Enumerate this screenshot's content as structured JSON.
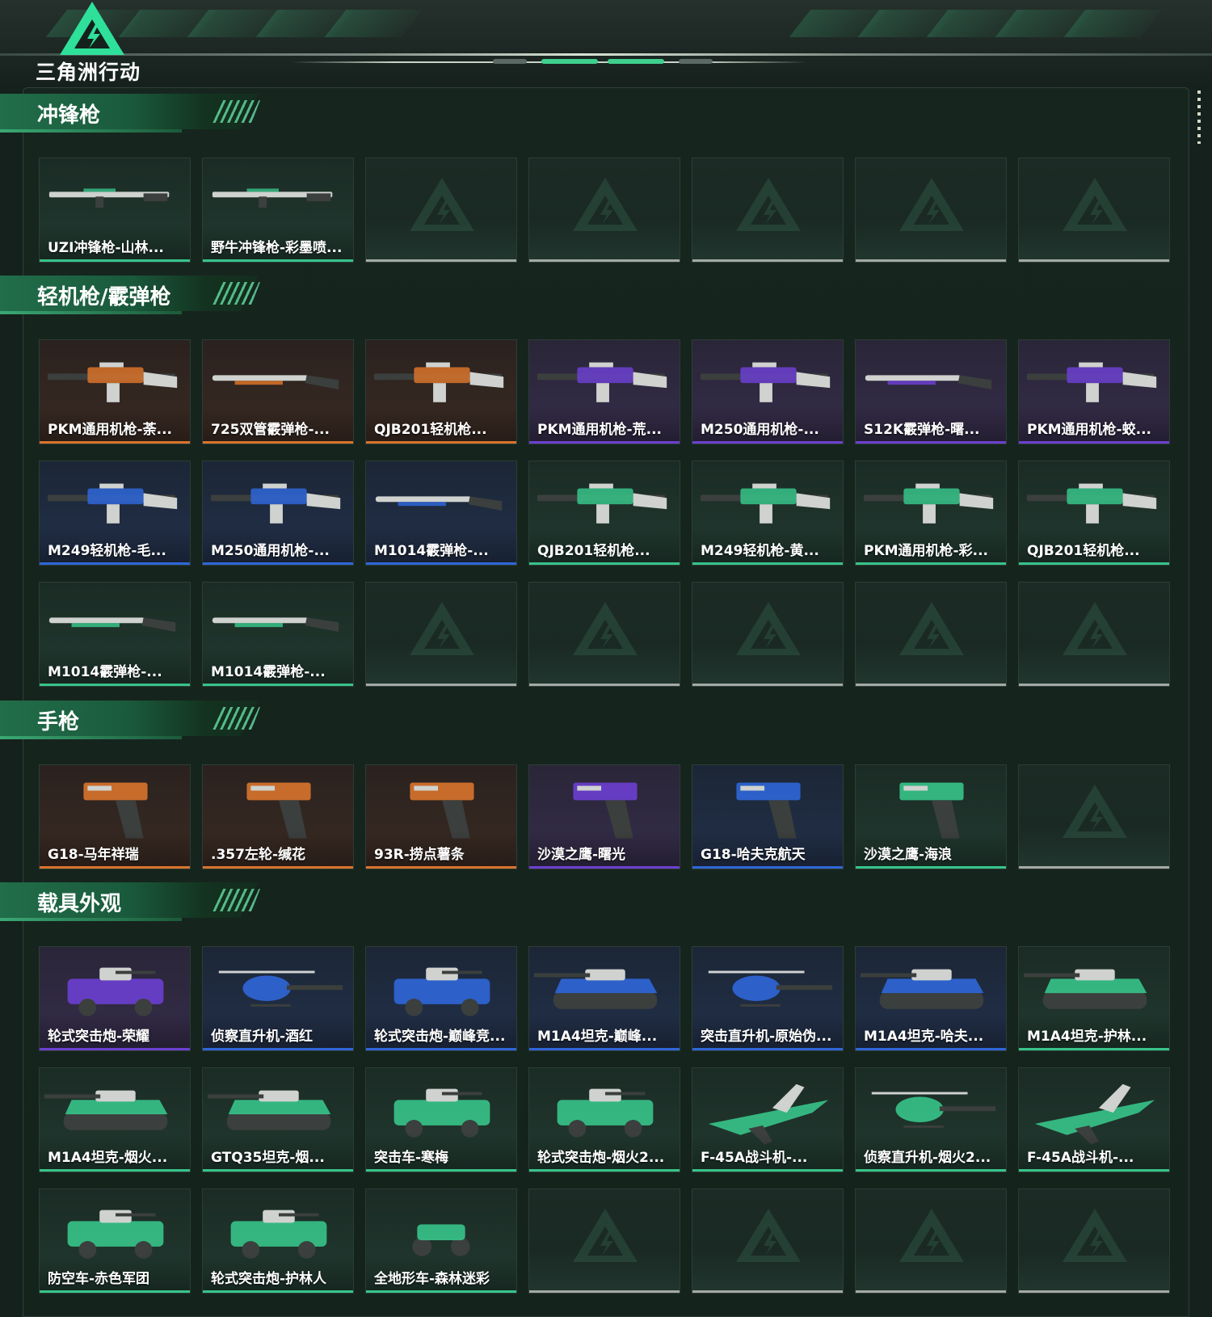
{
  "app": {
    "logo_text": "三角洲行动"
  },
  "colors": {
    "accent_green": "#37c48a",
    "rarity_orange": "#d8742c",
    "rarity_purple": "#6c3fd0",
    "rarity_blue": "#2f66d8",
    "rarity_green": "#37c48a",
    "empty_slot": "#a4aaa6"
  },
  "sections": [
    {
      "title": "冲锋枪",
      "items": [
        {
          "name": "UZI冲锋枪-山林...",
          "rarity": "green",
          "icon": "rifle-icon"
        },
        {
          "name": "野牛冲锋枪-彩墨喷...",
          "rarity": "green",
          "icon": "rifle-icon"
        },
        {
          "name": "",
          "rarity": "empty"
        },
        {
          "name": "",
          "rarity": "empty"
        },
        {
          "name": "",
          "rarity": "empty"
        },
        {
          "name": "",
          "rarity": "empty"
        },
        {
          "name": "",
          "rarity": "empty"
        }
      ]
    },
    {
      "title": "轻机枪/霰弹枪",
      "items": [
        {
          "name": "PKM通用机枪-荼...",
          "rarity": "orange",
          "icon": "machine-gun-icon"
        },
        {
          "name": "725双管霰弹枪-...",
          "rarity": "orange",
          "icon": "shotgun-icon"
        },
        {
          "name": "QJB201轻机枪...",
          "rarity": "orange",
          "icon": "machine-gun-icon"
        },
        {
          "name": "PKM通用机枪-荒...",
          "rarity": "purple",
          "icon": "machine-gun-icon"
        },
        {
          "name": "M250通用机枪-...",
          "rarity": "purple",
          "icon": "machine-gun-icon"
        },
        {
          "name": "S12K霰弹枪-曙...",
          "rarity": "purple",
          "icon": "shotgun-icon"
        },
        {
          "name": "PKM通用机枪-蛟...",
          "rarity": "purple",
          "icon": "machine-gun-icon"
        },
        {
          "name": "M249轻机枪-毛...",
          "rarity": "blue",
          "icon": "machine-gun-icon"
        },
        {
          "name": "M250通用机枪-...",
          "rarity": "blue",
          "icon": "machine-gun-icon"
        },
        {
          "name": "M1014霰弹枪-...",
          "rarity": "blue",
          "icon": "shotgun-icon"
        },
        {
          "name": "QJB201轻机枪...",
          "rarity": "green",
          "icon": "machine-gun-icon"
        },
        {
          "name": "M249轻机枪-黄...",
          "rarity": "green",
          "icon": "machine-gun-icon"
        },
        {
          "name": "PKM通用机枪-彩...",
          "rarity": "green",
          "icon": "machine-gun-icon"
        },
        {
          "name": "QJB201轻机枪...",
          "rarity": "green",
          "icon": "machine-gun-icon"
        },
        {
          "name": "M1014霰弹枪-...",
          "rarity": "green",
          "icon": "shotgun-icon"
        },
        {
          "name": "M1014霰弹枪-...",
          "rarity": "green",
          "icon": "shotgun-icon"
        },
        {
          "name": "",
          "rarity": "empty"
        },
        {
          "name": "",
          "rarity": "empty"
        },
        {
          "name": "",
          "rarity": "empty"
        },
        {
          "name": "",
          "rarity": "empty"
        },
        {
          "name": "",
          "rarity": "empty"
        }
      ]
    },
    {
      "title": "手枪",
      "items": [
        {
          "name": "G18-马年祥瑞",
          "rarity": "orange",
          "icon": "pistol-icon"
        },
        {
          "name": ".357左轮-缄花",
          "rarity": "orange",
          "icon": "revolver-icon"
        },
        {
          "name": "93R-捞点薯条",
          "rarity": "orange",
          "icon": "pistol-icon"
        },
        {
          "name": "沙漠之鹰-曙光",
          "rarity": "purple",
          "icon": "pistol-icon"
        },
        {
          "name": "G18-哈夫克航天",
          "rarity": "blue",
          "icon": "pistol-icon"
        },
        {
          "name": "沙漠之鹰-海浪",
          "rarity": "green",
          "icon": "pistol-icon"
        },
        {
          "name": "",
          "rarity": "empty"
        }
      ]
    },
    {
      "title": "载具外观",
      "items": [
        {
          "name": "轮式突击炮-荣耀",
          "rarity": "purple",
          "icon": "armored-car-icon"
        },
        {
          "name": "侦察直升机-酒红",
          "rarity": "blue",
          "icon": "helicopter-icon"
        },
        {
          "name": "轮式突击炮-巅峰竞...",
          "rarity": "blue",
          "icon": "armored-car-icon"
        },
        {
          "name": "M1A4坦克-巅峰...",
          "rarity": "blue",
          "icon": "tank-icon"
        },
        {
          "name": "突击直升机-原始伪...",
          "rarity": "blue",
          "icon": "helicopter-icon"
        },
        {
          "name": "M1A4坦克-哈夫...",
          "rarity": "blue",
          "icon": "tank-icon"
        },
        {
          "name": "M1A4坦克-护林...",
          "rarity": "green",
          "icon": "tank-icon"
        },
        {
          "name": "M1A4坦克-烟火...",
          "rarity": "green",
          "icon": "tank-icon"
        },
        {
          "name": "GTQ35坦克-烟...",
          "rarity": "green",
          "icon": "tank-icon"
        },
        {
          "name": "突击车-寒梅",
          "rarity": "green",
          "icon": "armored-car-icon"
        },
        {
          "name": "轮式突击炮-烟火2...",
          "rarity": "green",
          "icon": "armored-car-icon"
        },
        {
          "name": "F-45A战斗机-...",
          "rarity": "green",
          "icon": "jet-icon"
        },
        {
          "name": "侦察直升机-烟火2...",
          "rarity": "green",
          "icon": "helicopter-icon"
        },
        {
          "name": "F-45A战斗机-...",
          "rarity": "green",
          "icon": "jet-icon"
        },
        {
          "name": "防空车-赤色军团",
          "rarity": "green",
          "icon": "armored-car-icon"
        },
        {
          "name": "轮式突击炮-护林人",
          "rarity": "green",
          "icon": "armored-car-icon"
        },
        {
          "name": "全地形车-森林迷彩",
          "rarity": "green",
          "icon": "atv-icon"
        },
        {
          "name": "",
          "rarity": "empty"
        },
        {
          "name": "",
          "rarity": "empty"
        },
        {
          "name": "",
          "rarity": "empty"
        },
        {
          "name": "",
          "rarity": "empty"
        }
      ]
    }
  ]
}
